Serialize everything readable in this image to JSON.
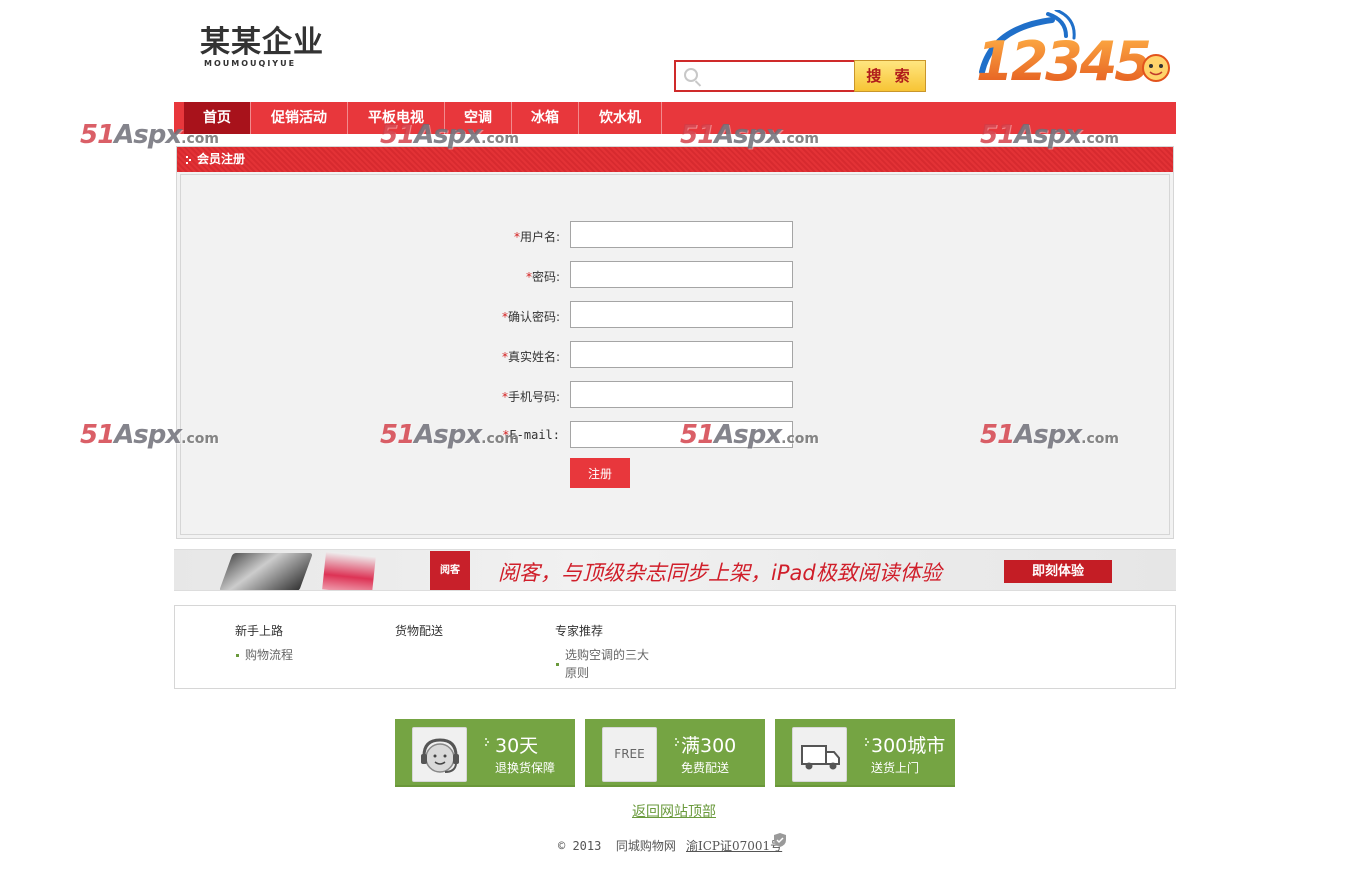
{
  "header": {
    "logo_cn": "某某企业",
    "logo_en": "MOUMOUQIYUE",
    "search_placeholder": "",
    "search_button": "搜 索",
    "brand_logo_text": "12345"
  },
  "nav": {
    "items": [
      {
        "label": "首页",
        "active": true
      },
      {
        "label": "促销活动",
        "active": false
      },
      {
        "label": "平板电视",
        "active": false
      },
      {
        "label": "空调",
        "active": false
      },
      {
        "label": "冰箱",
        "active": false
      },
      {
        "label": "饮水机",
        "active": false
      }
    ]
  },
  "register": {
    "title": "会员注册",
    "star": "*",
    "fields": [
      {
        "label": "用户名:",
        "value": ""
      },
      {
        "label": "密码:",
        "value": ""
      },
      {
        "label": "确认密码:",
        "value": ""
      },
      {
        "label": "真实姓名:",
        "value": ""
      },
      {
        "label": "手机号码:",
        "value": ""
      },
      {
        "label": "E-mail:",
        "value": ""
      }
    ],
    "submit_label": "注册"
  },
  "watermark": {
    "main": "51",
    "mid": "Aspx",
    "suffix": ".com"
  },
  "banner": {
    "logo_text": "阅客",
    "text": "阅客，与顶级杂志同步上架，iPad极致阅读体验",
    "button": "即刻体验"
  },
  "help": {
    "columns": [
      {
        "title": "新手上路",
        "links": [
          "购物流程"
        ]
      },
      {
        "title": "货物配送",
        "links": []
      },
      {
        "title": "专家推荐",
        "links": [
          "选购空调的三大原则"
        ]
      }
    ]
  },
  "services": [
    {
      "big": "30天",
      "small": "退换货保障",
      "icon": "headset-icon",
      "icon_text": ""
    },
    {
      "big": "满300",
      "small": "免费配送",
      "icon": "free-icon",
      "icon_text": "FREE"
    },
    {
      "big": "300城市",
      "small": "送货上门",
      "icon": "truck-icon",
      "icon_text": ""
    }
  ],
  "footer": {
    "back_top": "返回网站顶部",
    "copyright_year": "© 2013",
    "site_name": "同城购物网",
    "icp": "渝ICP证07001号"
  },
  "colors": {
    "nav_red": "#e8373c",
    "nav_active": "#a8121b",
    "service_green": "#75a443",
    "link_green": "#6a9a3c"
  }
}
